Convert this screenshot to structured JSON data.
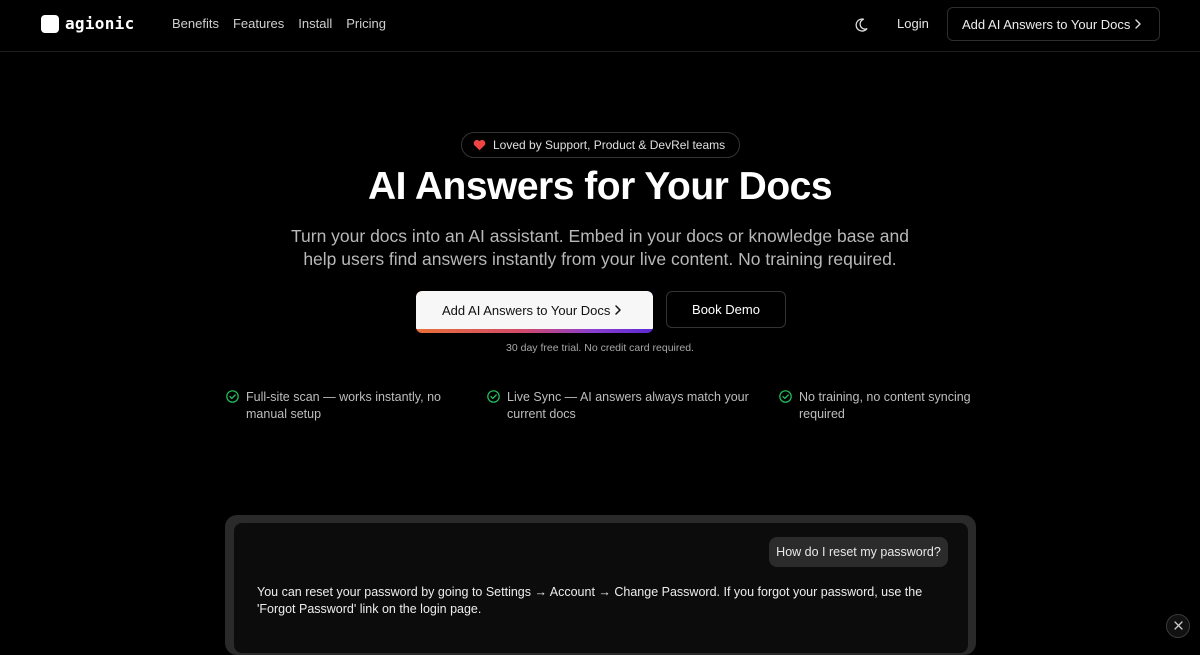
{
  "brand": {
    "name": "agionic"
  },
  "nav": {
    "links": [
      "Benefits",
      "Features",
      "Install",
      "Pricing"
    ],
    "login": "Login",
    "cta": "Add AI Answers to Your Docs"
  },
  "hero": {
    "badge": "Loved by Support, Product & DevRel teams",
    "title": "AI Answers for Your Docs",
    "subtitle": "Turn your docs into an AI assistant. Embed in your docs or knowledge base and help users find answers instantly from your live content. No training required.",
    "primary_cta": "Add AI Answers to Your Docs",
    "secondary_cta": "Book Demo",
    "note": "30 day free trial. No credit card required."
  },
  "features": [
    "Full-site scan — works instantly, no manual setup",
    "Live Sync — AI answers always match your current docs",
    "No training, no content syncing required"
  ],
  "demo": {
    "question": "How do I reset my password?",
    "answer": "You can reset your password by going to Settings → Account → Change Password. If you forgot your password, use the 'Forgot Password' link on the login page."
  },
  "colors": {
    "background": "#000000",
    "check": "#22c55e",
    "heart": "#ef4444",
    "cta_gradient": [
      "#e8713a",
      "#d14a6a",
      "#8a3ecf",
      "#5a2ad0"
    ]
  },
  "icons": [
    "moon-icon",
    "chevron-right-icon",
    "heart-icon",
    "check-circle-icon",
    "close-icon"
  ]
}
